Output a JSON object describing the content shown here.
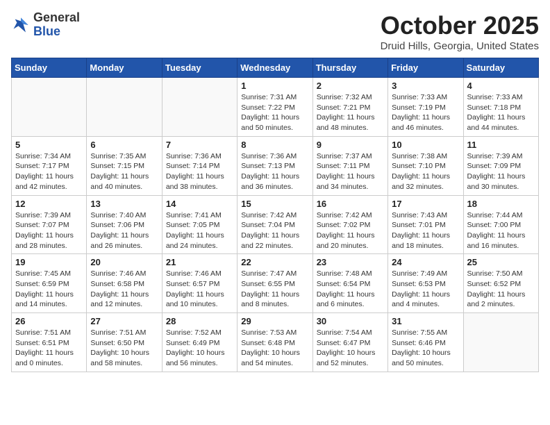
{
  "header": {
    "logo_general": "General",
    "logo_blue": "Blue",
    "month_title": "October 2025",
    "location": "Druid Hills, Georgia, United States"
  },
  "days_of_week": [
    "Sunday",
    "Monday",
    "Tuesday",
    "Wednesday",
    "Thursday",
    "Friday",
    "Saturday"
  ],
  "weeks": [
    [
      {
        "day": "",
        "info": ""
      },
      {
        "day": "",
        "info": ""
      },
      {
        "day": "",
        "info": ""
      },
      {
        "day": "1",
        "info": "Sunrise: 7:31 AM\nSunset: 7:22 PM\nDaylight: 11 hours and 50 minutes."
      },
      {
        "day": "2",
        "info": "Sunrise: 7:32 AM\nSunset: 7:21 PM\nDaylight: 11 hours and 48 minutes."
      },
      {
        "day": "3",
        "info": "Sunrise: 7:33 AM\nSunset: 7:19 PM\nDaylight: 11 hours and 46 minutes."
      },
      {
        "day": "4",
        "info": "Sunrise: 7:33 AM\nSunset: 7:18 PM\nDaylight: 11 hours and 44 minutes."
      }
    ],
    [
      {
        "day": "5",
        "info": "Sunrise: 7:34 AM\nSunset: 7:17 PM\nDaylight: 11 hours and 42 minutes."
      },
      {
        "day": "6",
        "info": "Sunrise: 7:35 AM\nSunset: 7:15 PM\nDaylight: 11 hours and 40 minutes."
      },
      {
        "day": "7",
        "info": "Sunrise: 7:36 AM\nSunset: 7:14 PM\nDaylight: 11 hours and 38 minutes."
      },
      {
        "day": "8",
        "info": "Sunrise: 7:36 AM\nSunset: 7:13 PM\nDaylight: 11 hours and 36 minutes."
      },
      {
        "day": "9",
        "info": "Sunrise: 7:37 AM\nSunset: 7:11 PM\nDaylight: 11 hours and 34 minutes."
      },
      {
        "day": "10",
        "info": "Sunrise: 7:38 AM\nSunset: 7:10 PM\nDaylight: 11 hours and 32 minutes."
      },
      {
        "day": "11",
        "info": "Sunrise: 7:39 AM\nSunset: 7:09 PM\nDaylight: 11 hours and 30 minutes."
      }
    ],
    [
      {
        "day": "12",
        "info": "Sunrise: 7:39 AM\nSunset: 7:07 PM\nDaylight: 11 hours and 28 minutes."
      },
      {
        "day": "13",
        "info": "Sunrise: 7:40 AM\nSunset: 7:06 PM\nDaylight: 11 hours and 26 minutes."
      },
      {
        "day": "14",
        "info": "Sunrise: 7:41 AM\nSunset: 7:05 PM\nDaylight: 11 hours and 24 minutes."
      },
      {
        "day": "15",
        "info": "Sunrise: 7:42 AM\nSunset: 7:04 PM\nDaylight: 11 hours and 22 minutes."
      },
      {
        "day": "16",
        "info": "Sunrise: 7:42 AM\nSunset: 7:02 PM\nDaylight: 11 hours and 20 minutes."
      },
      {
        "day": "17",
        "info": "Sunrise: 7:43 AM\nSunset: 7:01 PM\nDaylight: 11 hours and 18 minutes."
      },
      {
        "day": "18",
        "info": "Sunrise: 7:44 AM\nSunset: 7:00 PM\nDaylight: 11 hours and 16 minutes."
      }
    ],
    [
      {
        "day": "19",
        "info": "Sunrise: 7:45 AM\nSunset: 6:59 PM\nDaylight: 11 hours and 14 minutes."
      },
      {
        "day": "20",
        "info": "Sunrise: 7:46 AM\nSunset: 6:58 PM\nDaylight: 11 hours and 12 minutes."
      },
      {
        "day": "21",
        "info": "Sunrise: 7:46 AM\nSunset: 6:57 PM\nDaylight: 11 hours and 10 minutes."
      },
      {
        "day": "22",
        "info": "Sunrise: 7:47 AM\nSunset: 6:55 PM\nDaylight: 11 hours and 8 minutes."
      },
      {
        "day": "23",
        "info": "Sunrise: 7:48 AM\nSunset: 6:54 PM\nDaylight: 11 hours and 6 minutes."
      },
      {
        "day": "24",
        "info": "Sunrise: 7:49 AM\nSunset: 6:53 PM\nDaylight: 11 hours and 4 minutes."
      },
      {
        "day": "25",
        "info": "Sunrise: 7:50 AM\nSunset: 6:52 PM\nDaylight: 11 hours and 2 minutes."
      }
    ],
    [
      {
        "day": "26",
        "info": "Sunrise: 7:51 AM\nSunset: 6:51 PM\nDaylight: 11 hours and 0 minutes."
      },
      {
        "day": "27",
        "info": "Sunrise: 7:51 AM\nSunset: 6:50 PM\nDaylight: 10 hours and 58 minutes."
      },
      {
        "day": "28",
        "info": "Sunrise: 7:52 AM\nSunset: 6:49 PM\nDaylight: 10 hours and 56 minutes."
      },
      {
        "day": "29",
        "info": "Sunrise: 7:53 AM\nSunset: 6:48 PM\nDaylight: 10 hours and 54 minutes."
      },
      {
        "day": "30",
        "info": "Sunrise: 7:54 AM\nSunset: 6:47 PM\nDaylight: 10 hours and 52 minutes."
      },
      {
        "day": "31",
        "info": "Sunrise: 7:55 AM\nSunset: 6:46 PM\nDaylight: 10 hours and 50 minutes."
      },
      {
        "day": "",
        "info": ""
      }
    ]
  ]
}
